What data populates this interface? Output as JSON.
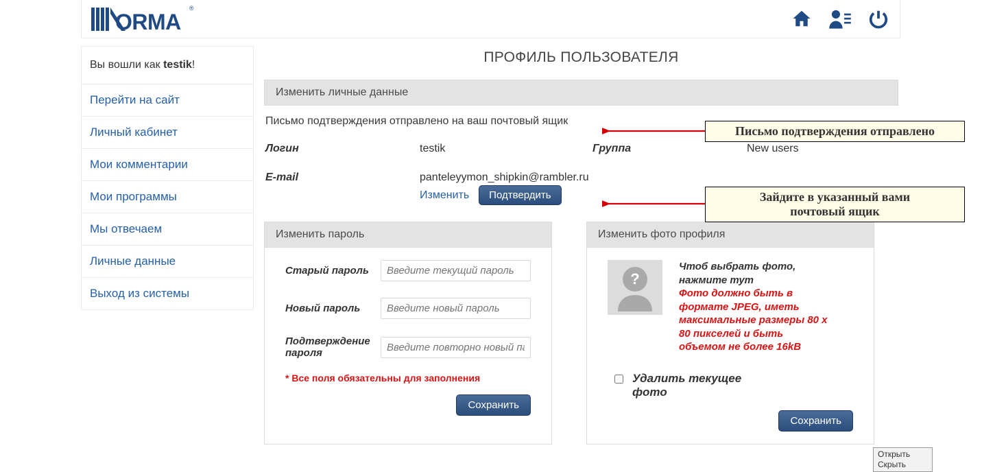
{
  "header": {
    "logo_alt": "Norma"
  },
  "sidebar": {
    "logged_prefix": "Вы вошли как ",
    "username": "testik",
    "exclaim": "!",
    "items": [
      "Перейти на сайт",
      "Личный кабинет",
      "Мои комментарии",
      "Мои программы",
      "Мы отвечаем",
      "Личные данные",
      "Выход из системы"
    ]
  },
  "main": {
    "title": "ПРОФИЛЬ ПОЛЬЗОВАТЕЛЯ",
    "personal_data_hdr": "Изменить личные данные",
    "confirm_notice": "Письмо подтверждения отправлено на ваш почтовый ящик",
    "login_label": "Логин",
    "login_value": "testik",
    "group_label": "Группа",
    "group_value": "New users",
    "email_label": "E-mail",
    "email_value": "panteleyymon_shipkin@rambler.ru",
    "edit_link": "Изменить",
    "confirm_btn": "Подтвердить"
  },
  "password_panel": {
    "hdr": "Изменить пароль",
    "old_label": "Старый пароль",
    "old_ph": "Введите текущий пароль",
    "new_label": "Новый пароль",
    "new_ph": "Введите новый пароль",
    "confirm_label": "Подтверждение пароля",
    "confirm_ph": "Введите повторно новый пароль",
    "required_note": "* Все поля обязательны для заполнения",
    "save_btn": "Сохранить"
  },
  "photo_panel": {
    "hdr": "Изменить фото профиля",
    "choose_text": "Чтоб выбрать фото, нажмите тут",
    "warn_text": "Фото должно быть в формате JPEG, иметь максимальные размеры 80 x 80 пикселей и быть объемом не более 16kB",
    "delete_label": "Удалить текущее фото",
    "save_btn": "Сохранить"
  },
  "callouts": {
    "c1": "Письмо подтверждения отправлено",
    "c2_line1": "Зайдите в указанный вами",
    "c2_line2": "почтовый ящик"
  },
  "popup": {
    "open": "Открыть",
    "hide": "Скрыть"
  }
}
